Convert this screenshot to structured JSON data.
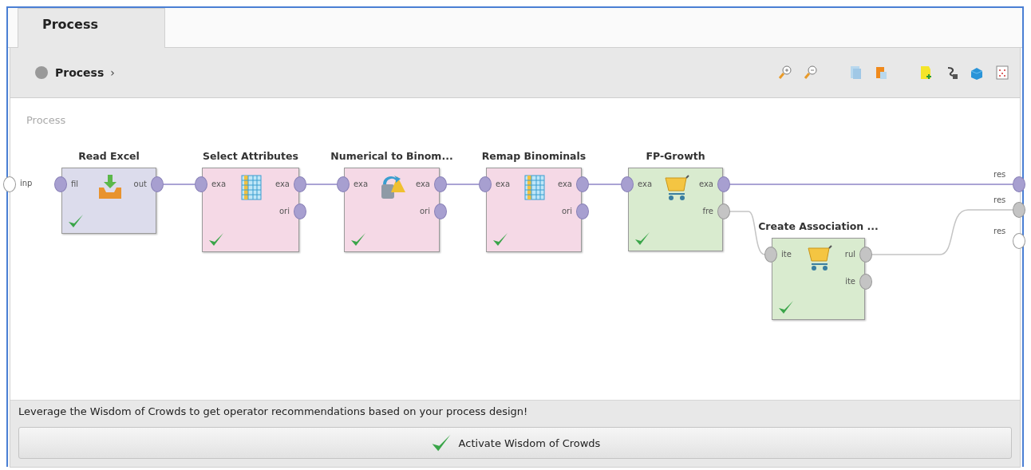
{
  "tabs": [
    {
      "label": "Process",
      "selected": true
    }
  ],
  "breadcrumb": {
    "label": "Process",
    "arrow": "›"
  },
  "canvas": {
    "label": "Process",
    "process_inputs": [
      {
        "label": "inp",
        "kind": "empty"
      }
    ],
    "process_outputs": [
      {
        "label": "res",
        "kind": "example"
      },
      {
        "label": "res",
        "kind": "other"
      },
      {
        "label": "res",
        "kind": "empty"
      }
    ],
    "operators": [
      {
        "title": "Read Excel",
        "kind": "data",
        "ok": true,
        "inputs": [
          {
            "label": "fil",
            "kind": "file"
          }
        ],
        "outputs": [
          {
            "label": "out",
            "kind": "example"
          }
        ]
      },
      {
        "title": "Select Attributes",
        "kind": "transform",
        "ok": true,
        "inputs": [
          {
            "label": "exa",
            "kind": "example"
          }
        ],
        "outputs": [
          {
            "label": "exa",
            "kind": "example"
          },
          {
            "label": "ori",
            "kind": "example"
          }
        ]
      },
      {
        "title": "Numerical to Binom...",
        "kind": "transform",
        "ok": true,
        "inputs": [
          {
            "label": "exa",
            "kind": "example"
          }
        ],
        "outputs": [
          {
            "label": "exa",
            "kind": "example"
          },
          {
            "label": "ori",
            "kind": "example"
          }
        ]
      },
      {
        "title": "Remap Binominals",
        "kind": "transform",
        "ok": true,
        "inputs": [
          {
            "label": "exa",
            "kind": "example"
          }
        ],
        "outputs": [
          {
            "label": "exa",
            "kind": "example"
          },
          {
            "label": "ori",
            "kind": "example"
          }
        ]
      },
      {
        "title": "FP-Growth",
        "kind": "model",
        "ok": true,
        "inputs": [
          {
            "label": "exa",
            "kind": "example"
          }
        ],
        "outputs": [
          {
            "label": "exa",
            "kind": "example"
          },
          {
            "label": "fre",
            "kind": "other"
          }
        ]
      },
      {
        "title": "Create Association ...",
        "kind": "model",
        "ok": true,
        "inputs": [
          {
            "label": "ite",
            "kind": "other"
          }
        ],
        "outputs": [
          {
            "label": "rul",
            "kind": "other"
          },
          {
            "label": "ite",
            "kind": "other"
          }
        ]
      }
    ]
  },
  "footer": {
    "message": "Leverage the Wisdom of Crowds to get operator recommendations based on your process design!",
    "button": "Activate Wisdom of Crowds"
  }
}
